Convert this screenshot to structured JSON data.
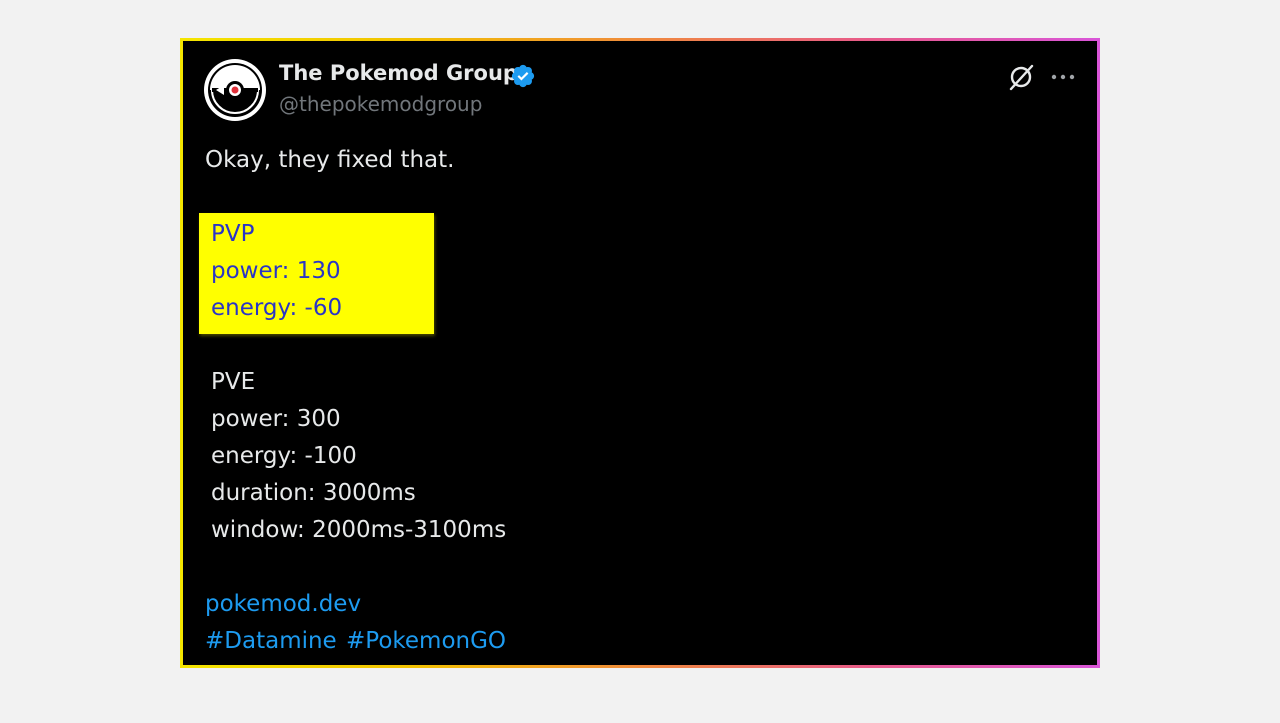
{
  "author": {
    "name": "The Pokemod Group",
    "handle": "@thepokemodgroup",
    "verified": true
  },
  "actions": {
    "grok_icon": "grok-icon",
    "more_icon": "more-horizontal-icon"
  },
  "tweet": {
    "intro": "Okay, they fixed that.",
    "pvp": {
      "heading": "PVP",
      "power": "power: 130",
      "energy": "energy: -60"
    },
    "pve": {
      "heading": "PVE",
      "power": "power: 300",
      "energy": "energy: -100",
      "duration": "duration: 3000ms",
      "window": "window: 2000ms-3100ms"
    },
    "link": "pokemod.dev",
    "hashtags": [
      "#Datamine",
      "#PokemonGO"
    ]
  },
  "colors": {
    "background": "#000000",
    "text": "#e7e9ea",
    "muted": "#71767b",
    "link": "#1d9bf0",
    "highlight": "#ffff00",
    "highlight_text": "#2a35c7",
    "verified": "#1d9bf0"
  }
}
